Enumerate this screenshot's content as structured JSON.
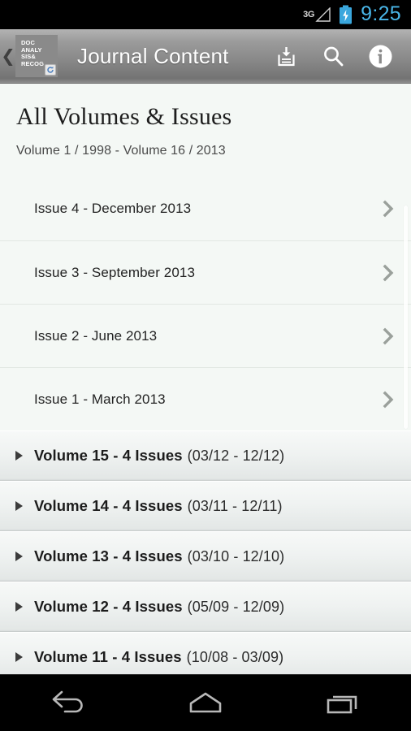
{
  "statusbar": {
    "network": "3G",
    "time": "9:25",
    "signal_icon": "signal-triangle-icon",
    "battery_icon": "battery-charging-icon",
    "time_color": "#49b6e8"
  },
  "actionbar": {
    "up_icon": "back-chevron-icon",
    "logo": {
      "text": "DOC\nANALY\nSIS&\nRECOG",
      "badge_icon": "refresh-badge-icon"
    },
    "title": "Journal Content",
    "actions": [
      {
        "name": "download-button",
        "icon": "save-to-inbox-icon",
        "label": "Download"
      },
      {
        "name": "search-button",
        "icon": "search-icon",
        "label": "Search"
      },
      {
        "name": "info-button",
        "icon": "info-circle-icon",
        "label": "Info"
      }
    ]
  },
  "main": {
    "title": "All Volumes & Issues",
    "subtitle": "Volume 1 / 1998 - Volume 16 / 2013",
    "issues": [
      {
        "label": "Issue 4 - December 2013",
        "chevron_icon": "chevron-right-icon"
      },
      {
        "label": "Issue 3 - September 2013",
        "chevron_icon": "chevron-right-icon"
      },
      {
        "label": "Issue 2 - June 2013",
        "chevron_icon": "chevron-right-icon"
      },
      {
        "label": "Issue 1 - March 2013",
        "chevron_icon": "chevron-right-icon"
      }
    ],
    "volumes": [
      {
        "title": "Volume 15 - 4 Issues",
        "range": "(03/12  -  12/12)",
        "expander_icon": "triangle-right-icon"
      },
      {
        "title": "Volume 14 - 4 Issues",
        "range": "(03/11  -  12/11)",
        "expander_icon": "triangle-right-icon"
      },
      {
        "title": "Volume 13 - 4 Issues",
        "range": "(03/10  -  12/10)",
        "expander_icon": "triangle-right-icon"
      },
      {
        "title": "Volume 12 - 4 Issues",
        "range": "(05/09  -  12/09)",
        "expander_icon": "triangle-right-icon"
      },
      {
        "title": "Volume 11 - 4 Issues",
        "range": "(10/08  -  03/09)",
        "expander_icon": "triangle-right-icon"
      }
    ]
  },
  "navbar": {
    "buttons": [
      {
        "name": "nav-back-button",
        "icon": "back-arrow-icon",
        "label": "Back"
      },
      {
        "name": "nav-home-button",
        "icon": "home-icon",
        "label": "Home"
      },
      {
        "name": "nav-recents-button",
        "icon": "recents-icon",
        "label": "Recent apps"
      }
    ]
  }
}
